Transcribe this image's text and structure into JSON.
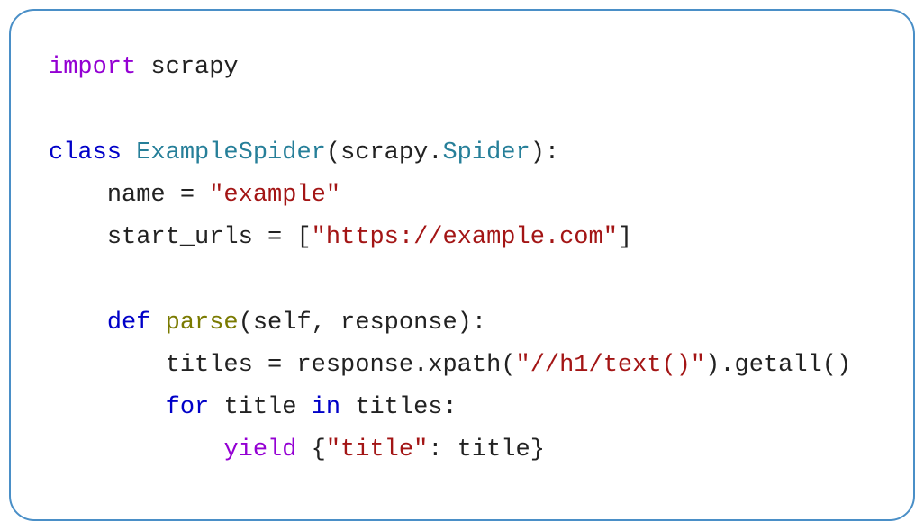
{
  "code": {
    "line1": {
      "import_kw": "import",
      "module": "scrapy"
    },
    "line3": {
      "class_kw": "class",
      "class_name": "ExampleSpider",
      "open": "(",
      "base_ns": "scrapy",
      "dot": ".",
      "base_cls": "Spider",
      "close": "):"
    },
    "line4": {
      "indent": "    ",
      "lhs": "name",
      "eq": " = ",
      "rhs": "\"example\""
    },
    "line5": {
      "indent": "    ",
      "lhs": "start_urls",
      "eq": " = ",
      "lbr": "[",
      "url": "\"https://example.com\"",
      "rbr": "]"
    },
    "line7": {
      "indent": "    ",
      "def_kw": "def",
      "space": " ",
      "fn_name": "parse",
      "params": "(self, response):"
    },
    "line8": {
      "indent": "        ",
      "lhs": "titles",
      "eq": " = ",
      "expr_pre": "response.xpath(",
      "arg": "\"//h1/text()\"",
      "expr_post": ").getall()"
    },
    "line9": {
      "indent": "        ",
      "for_kw": "for",
      "sp1": " ",
      "var": "title",
      "sp2": " ",
      "in_kw": "in",
      "sp3": " ",
      "iter": "titles:"
    },
    "line10": {
      "indent": "            ",
      "yield_kw": "yield",
      "sp": " ",
      "lbrace": "{",
      "key": "\"title\"",
      "colon": ": ",
      "val": "title",
      "rbrace": "}"
    }
  }
}
